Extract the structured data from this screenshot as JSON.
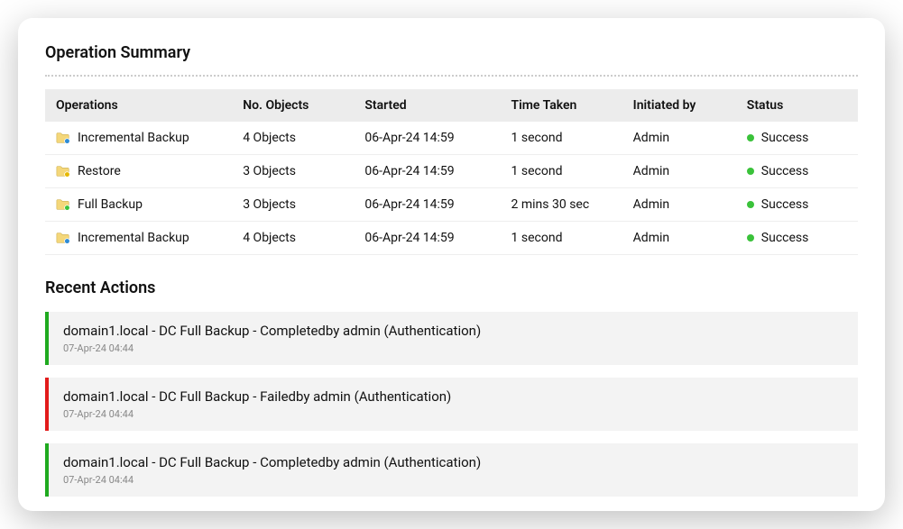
{
  "operation_summary": {
    "title": "Operation Summary",
    "headers": {
      "operations": "Operations",
      "no_objects": "No. Objects",
      "started": "Started",
      "time_taken": "Time Taken",
      "initiated_by": "Initiated by",
      "status": "Status"
    },
    "rows": [
      {
        "icon": "incremental",
        "operation": "Incremental Backup",
        "objects": "4 Objects",
        "started": "06-Apr-24 14:59",
        "time_taken": "1 second",
        "initiated_by": "Admin",
        "status": "Success",
        "status_color": "#3ac23a"
      },
      {
        "icon": "restore",
        "operation": "Restore",
        "objects": "3 Objects",
        "started": "06-Apr-24 14:59",
        "time_taken": "1 second",
        "initiated_by": "Admin",
        "status": "Success",
        "status_color": "#3ac23a"
      },
      {
        "icon": "full",
        "operation": "Full Backup",
        "objects": "3 Objects",
        "started": "06-Apr-24 14:59",
        "time_taken": "2 mins 30 sec",
        "initiated_by": "Admin",
        "status": "Success",
        "status_color": "#3ac23a"
      },
      {
        "icon": "incremental",
        "operation": "Incremental Backup",
        "objects": "4 Objects",
        "started": "06-Apr-24 14:59",
        "time_taken": "1 second",
        "initiated_by": "Admin",
        "status": "Success",
        "status_color": "#3ac23a"
      }
    ]
  },
  "recent_actions": {
    "title": "Recent Actions",
    "items": [
      {
        "status": "green",
        "text": "domain1.local - DC Full Backup - Completedby admin (Authentication)",
        "timestamp": "07-Apr-24 04:44"
      },
      {
        "status": "red",
        "text": "domain1.local - DC Full Backup - Failedby admin (Authentication)",
        "timestamp": "07-Apr-24 04:44"
      },
      {
        "status": "green",
        "text": "domain1.local - DC Full Backup - Completedby admin (Authentication)",
        "timestamp": "07-Apr-24 04:44"
      }
    ]
  }
}
